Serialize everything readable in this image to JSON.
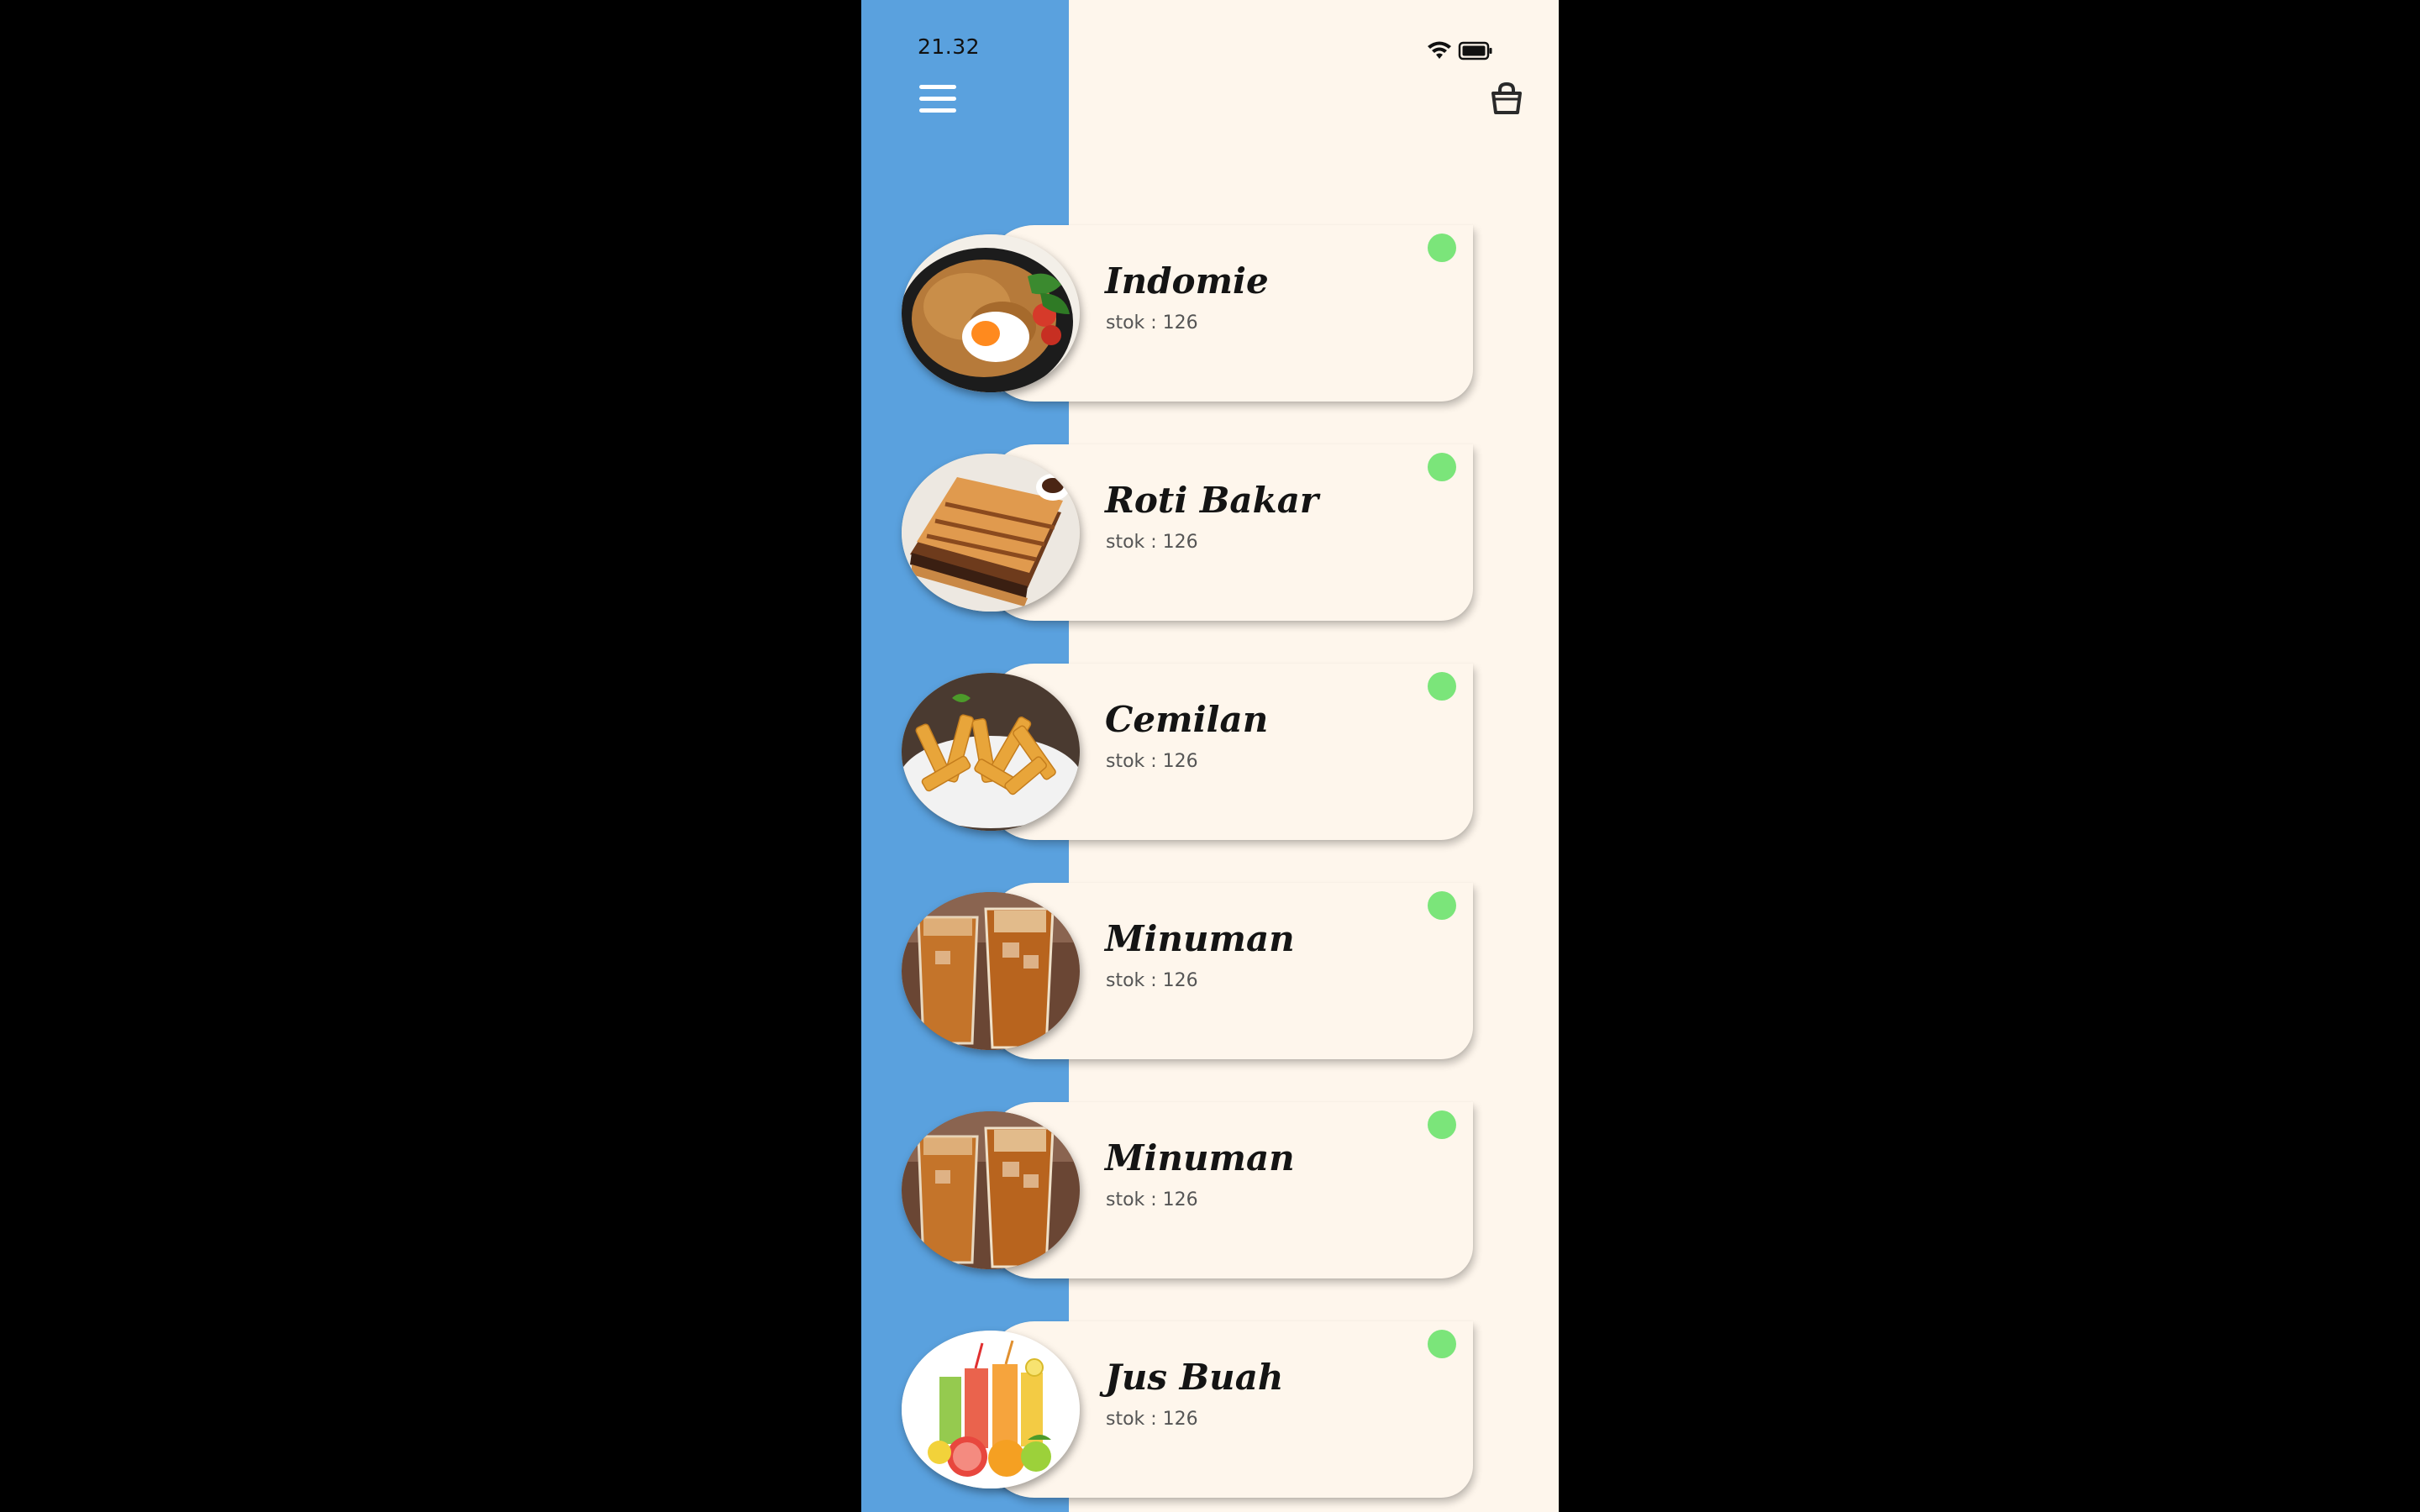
{
  "status_bar": {
    "time": "21.32"
  },
  "colors": {
    "side_strip": "#5aa1de",
    "background": "#fef6ec",
    "status_dot": "#7be57a"
  },
  "header": {
    "menu_icon": "hamburger-menu-icon",
    "cart_icon": "shopping-bag-icon"
  },
  "menu_items": [
    {
      "name": "Indomie",
      "stock": "stok : 126",
      "image": "fried-noodle-egg"
    },
    {
      "name": "Roti Bakar",
      "stock": "stok : 126",
      "image": "toast-sandwich"
    },
    {
      "name": "Cemilan",
      "stock": "stok : 126",
      "image": "french-fries"
    },
    {
      "name": "Minuman",
      "stock": "stok : 126",
      "image": "iced-tea-glasses"
    },
    {
      "name": "Minuman",
      "stock": "stok : 126",
      "image": "iced-tea-glasses"
    },
    {
      "name": "Jus Buah",
      "stock": "stok : 126",
      "image": "fruit-juice-glasses"
    }
  ]
}
